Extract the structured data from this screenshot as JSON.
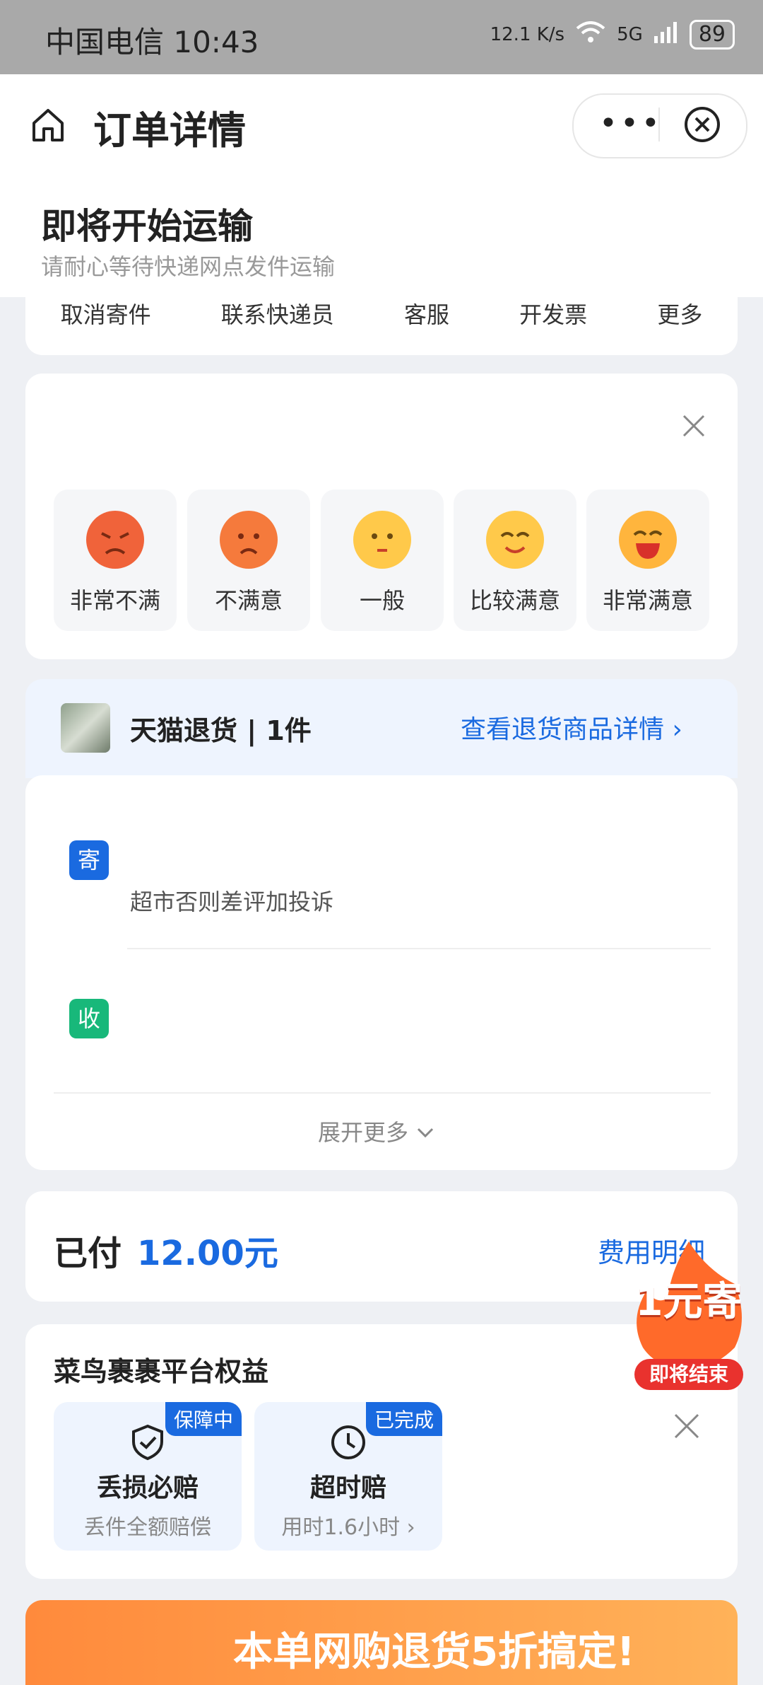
{
  "status_bar": {
    "carrier_time": "中国电信 10:43",
    "speed": "12.1 K/s",
    "network": "5G",
    "battery": "89"
  },
  "title_bar": {
    "title": "订单详情",
    "more_icon": "more-dots-icon",
    "close_icon": "close-circle-icon"
  },
  "order_status": {
    "title": "即将开始运输",
    "subtitle": "请耐心等待快递网点发件运输"
  },
  "actions": [
    "取消寄件",
    "联系快递员",
    "客服",
    "开发票",
    "更多"
  ],
  "rating": {
    "options": [
      {
        "label": "非常不满",
        "color": "#f0633a"
      },
      {
        "label": "不满意",
        "color": "#f57a3c"
      },
      {
        "label": "一般",
        "color": "#ffc94a"
      },
      {
        "label": "比较满意",
        "color": "#ffc94a"
      },
      {
        "label": "非常满意",
        "color": "#ffb53d"
      }
    ]
  },
  "return_goods": {
    "title": "天猫退货 | 1件",
    "link": "查看退货商品详情 ›"
  },
  "addresses": {
    "sender_tag": "寄",
    "sender_note": "超市否则差评加投诉",
    "receiver_tag": "收",
    "expand": "展开更多"
  },
  "payment": {
    "label": "已付",
    "amount": "12.00元",
    "detail_link": "费用明细"
  },
  "benefits": {
    "title": "菜鸟裹裹平台权益",
    "items": [
      {
        "badge": "保障中",
        "name": "丢损必赔",
        "desc": "丢件全额赔偿",
        "icon": "shield-check-icon"
      },
      {
        "badge": "已完成",
        "name": "超时赔",
        "desc": "用时1.6小时 ›",
        "icon": "clock-icon"
      }
    ]
  },
  "promo": {
    "main": "1元寄",
    "sub": "即将结束"
  },
  "banner": {
    "text": "本单网购退货5折搞定!"
  },
  "colors": {
    "accent": "#1a6ae0",
    "sender_tag": "#1a6ae0",
    "receiver_tag": "#18b87a"
  }
}
